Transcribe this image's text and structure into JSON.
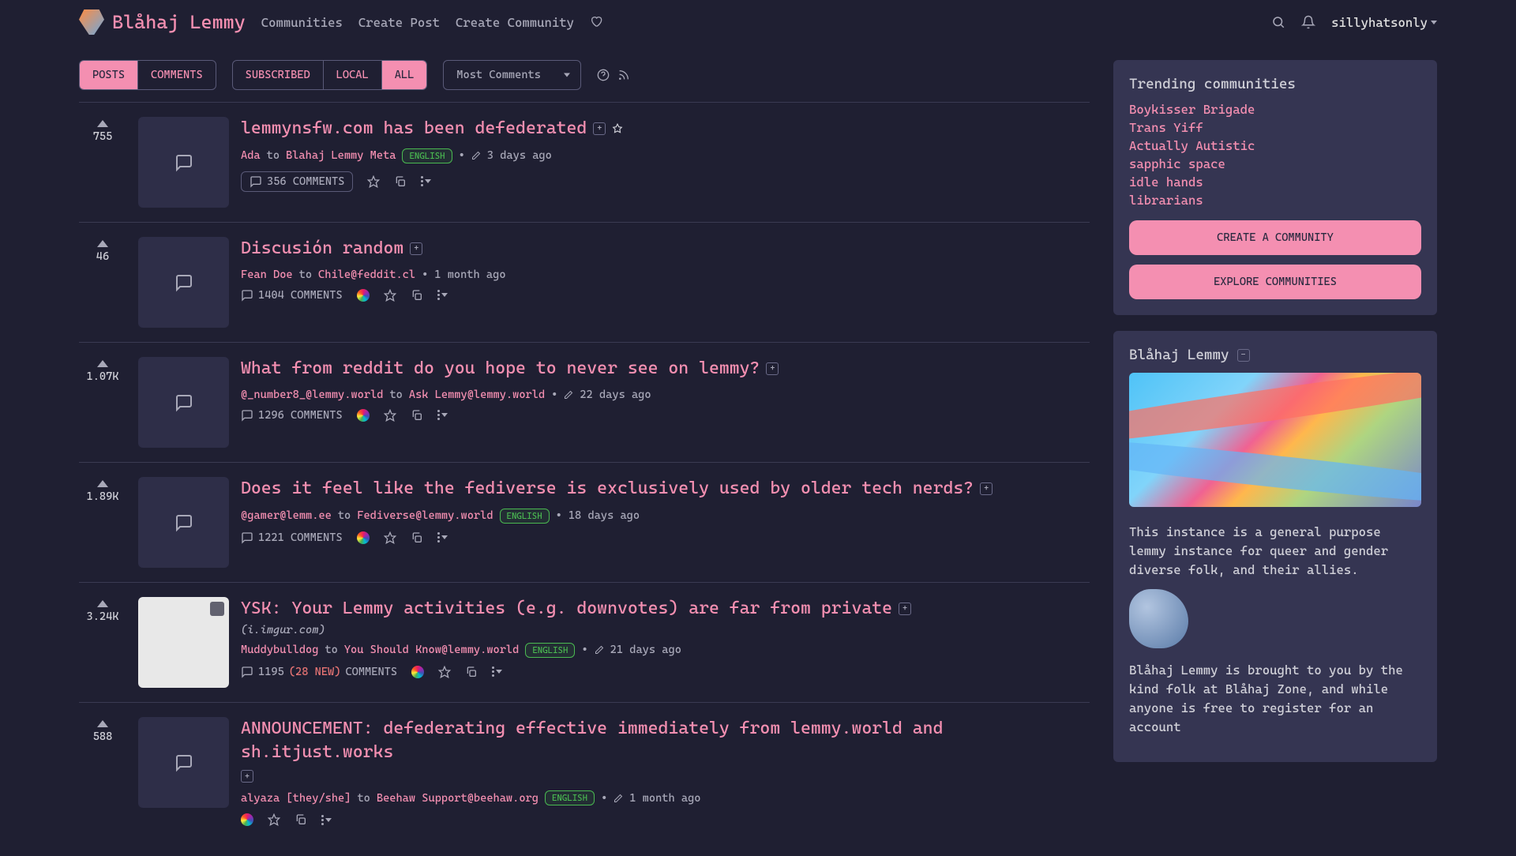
{
  "brand": "Blåhaj Lemmy",
  "nav": {
    "communities": "Communities",
    "create_post": "Create Post",
    "create_community": "Create Community"
  },
  "username": "sillyhatsonly",
  "tabs": {
    "posts": "POSTS",
    "comments": "COMMENTS",
    "subscribed": "SUBSCRIBED",
    "local": "LOCAL",
    "all": "ALL"
  },
  "sort": "Most Comments",
  "posts": [
    {
      "score": "755",
      "title": "lemmynsfw.com has been defederated",
      "pinned": true,
      "author": "Ada",
      "community": "Blahaj Lemmy Meta",
      "lang": "ENGLISH",
      "edited": true,
      "age": "3 days ago",
      "comments": "356 COMMENTS",
      "fedi": false,
      "commentsBtn": true
    },
    {
      "score": "46",
      "title": "Discusión random",
      "author": "Fean Doe",
      "community": "Chile@feddit.cl",
      "age": "1 month ago",
      "comments": "1404 COMMENTS",
      "fedi": true
    },
    {
      "score": "1.07K",
      "title": "What from reddit do you hope to never see on lemmy?",
      "author": "@_number8_@lemmy.world",
      "community": "Ask Lemmy@lemmy.world",
      "edited": true,
      "age": "22 days ago",
      "comments": "1296 COMMENTS",
      "fedi": true
    },
    {
      "score": "1.89K",
      "title": "Does it feel like the fediverse is exclusively used by older tech nerds?",
      "author": "@gamer@lemm.ee",
      "community": "Fediverse@lemmy.world",
      "lang": "ENGLISH",
      "age": "18 days ago",
      "comments": "1221 COMMENTS",
      "fedi": true
    },
    {
      "score": "3.24K",
      "title": "YSK: Your Lemmy activities (e.g. downvotes) are far from private",
      "subtitle": "(i.imgur.com)",
      "author": "Muddybulldog",
      "community": "You Should Know@lemmy.world",
      "lang": "ENGLISH",
      "edited": true,
      "age": "21 days ago",
      "comments_raw": "1195",
      "comments_new": "(28 NEW)",
      "comments_label": "COMMENTS",
      "fedi": true,
      "hasImage": true
    },
    {
      "score": "588",
      "title": "ANNOUNCEMENT: defederating effective immediately from lemmy.world and sh.itjust.works",
      "author": "alyaza [they/she]",
      "community": "Beehaw Support@beehaw.org",
      "lang": "ENGLISH",
      "edited": true,
      "age": "1 month ago",
      "fedi": true
    }
  ],
  "sidebar": {
    "trending_title": "Trending communities",
    "trending": [
      "Boykisser Brigade",
      "Trans Yiff",
      "Actually Autistic",
      "sapphic space",
      "idle hands",
      "librarians"
    ],
    "create_btn": "CREATE A COMMUNITY",
    "explore_btn": "EXPLORE COMMUNITIES",
    "instance_title": "Blåhaj Lemmy",
    "desc1": "This instance is a general purpose lemmy instance for queer and gender diverse folk, and their allies.",
    "desc2": "Blåhaj Lemmy is brought to you by the kind folk at Blåhaj Zone, and while anyone is free to register for an account"
  },
  "to_label": "to"
}
